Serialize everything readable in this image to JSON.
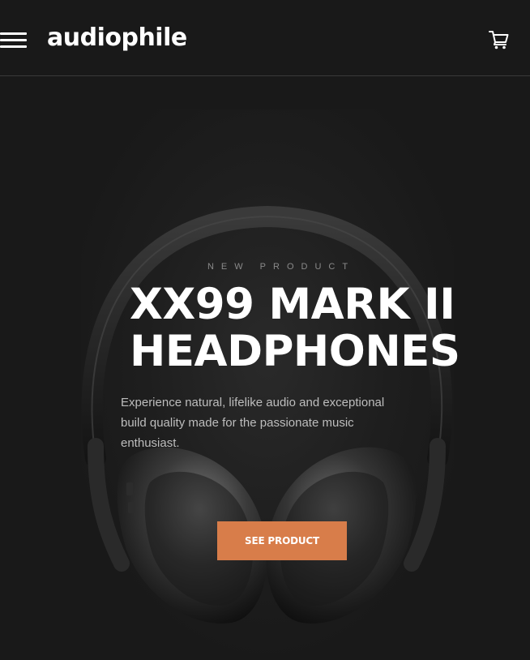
{
  "header": {
    "logo": "audiophile",
    "menu_icon": "hamburger-menu-icon",
    "cart_icon": "shopping-cart-icon"
  },
  "hero": {
    "overline": "NEW PRODUCT",
    "title_line1": "XX99 MARK II",
    "title_line2": "HEADPHONES",
    "description": "Experience natural, lifelike audio and exceptional build quality made for the passionate music enthusiast.",
    "cta_label": "SEE PRODUCT",
    "image": "headphones-product-image"
  },
  "colors": {
    "background": "#191919",
    "accent": "#d87d4a",
    "text_primary": "#ffffff",
    "text_muted": "#bdbdbd",
    "divider": "#3a3a3a"
  }
}
